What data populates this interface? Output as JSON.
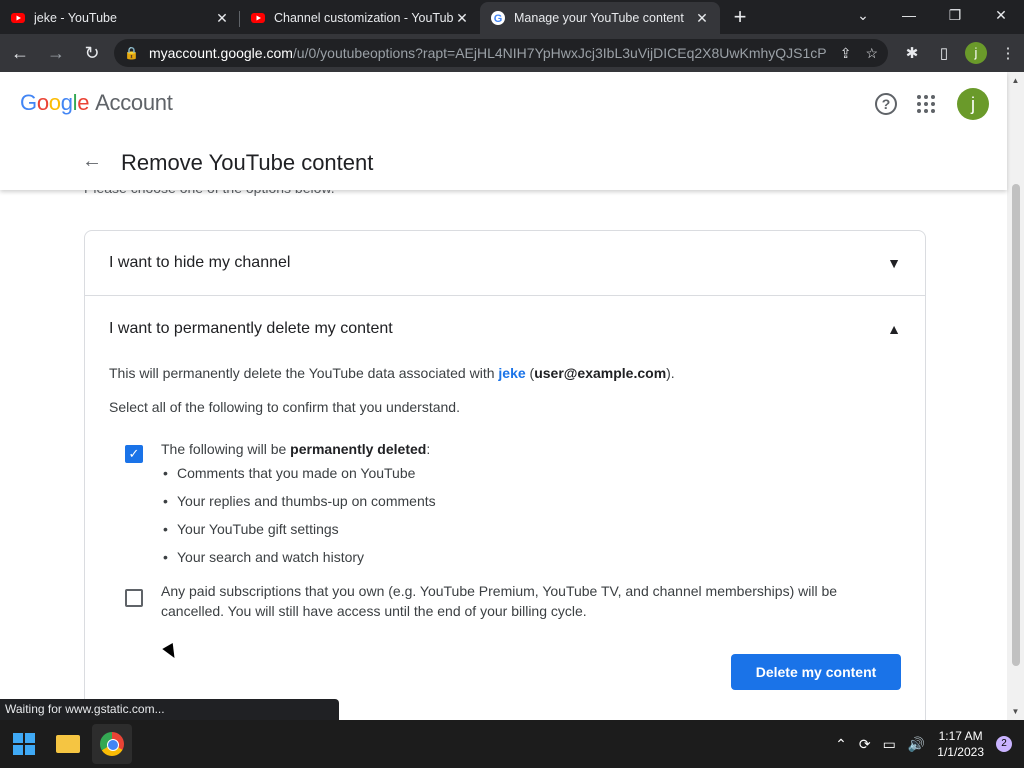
{
  "browser": {
    "tabs": [
      {
        "title": "jeke - YouTube",
        "favicon": "youtube-icon"
      },
      {
        "title": "Channel customization - YouTube",
        "favicon": "youtube-icon"
      },
      {
        "title": "Manage your YouTube content",
        "favicon": "google-icon"
      }
    ],
    "url_host": "myaccount.google.com",
    "url_path": "/u/0/youtubeoptions?rapt=AEjHL4NIH7YpHwxJcj3IbL3uVijDICEq2X8UwKmhyQJS1cP...",
    "avatar_initial": "j"
  },
  "header": {
    "logo_google": "Google",
    "logo_account": "Account",
    "avatar_initial": "j",
    "back_label": "←",
    "title": "Remove YouTube content",
    "subtext": "Please choose one of the options below."
  },
  "accordion": {
    "hide_title": "I want to hide my channel",
    "delete_title": "I want to permanently delete my content",
    "assoc_prefix": "This will permanently delete the YouTube data associated with ",
    "assoc_channel": "jeke",
    "assoc_email": "user@example.com",
    "assoc_suffix": ").",
    "confirm_prompt": "Select all of the following to confirm that you understand.",
    "opt1_lead": "The following will be ",
    "opt1_bold": "permanently deleted",
    "opt1_colon": ":",
    "opt1_items": [
      "Comments that you made on YouTube",
      "Your replies and thumbs-up on comments",
      "Your YouTube gift settings",
      "Your search and watch history"
    ],
    "opt1_checked": true,
    "opt2_text": "Any paid subscriptions that you own (e.g. YouTube Premium, YouTube TV, and channel memberships) will be cancelled. You will still have access until the end of your billing cycle.",
    "opt2_checked": false,
    "delete_button": "Delete my content"
  },
  "status_text": "Waiting for www.gstatic.com...",
  "taskbar": {
    "time": "1:17 AM",
    "date": "1/1/2023",
    "notifications": "2"
  }
}
